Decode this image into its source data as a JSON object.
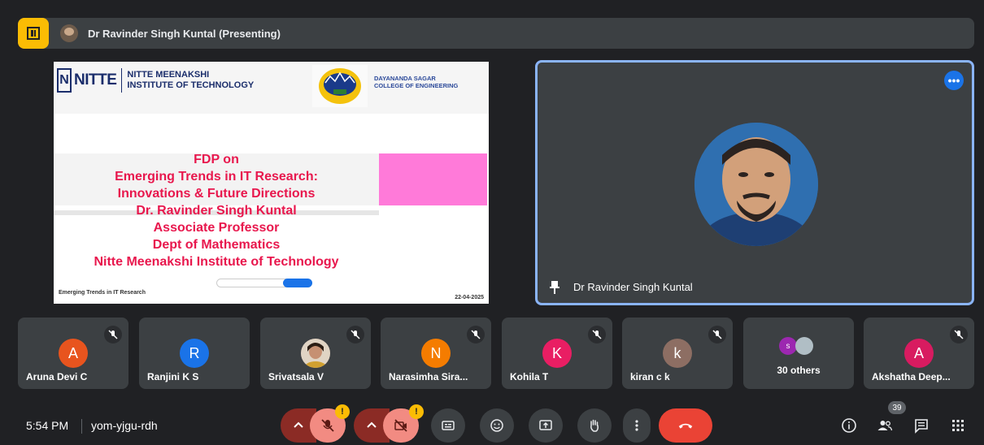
{
  "topbar": {
    "presenting_label": "Dr Ravinder Singh Kuntal (Presenting)"
  },
  "slide": {
    "nitte_word": "NITTE",
    "nitte_inst_line1": "NITTE MEENAKSHI",
    "nitte_inst_line2": "INSTITUTE OF TECHNOLOGY",
    "dsce_line1": "DAYANANDA SAGAR",
    "dsce_line2": "COLLEGE OF ENGINEERING",
    "lines": [
      "FDP on",
      "Emerging Trends in IT Research:",
      "Innovations & Future Directions",
      "Dr. Ravinder Singh Kuntal",
      "Associate Professor",
      "Dept of Mathematics",
      "Nitte Meenakshi Institute of Technology"
    ],
    "footer_left": "Emerging Trends in IT Research",
    "footer_right": "22-04-2025"
  },
  "speaker": {
    "name": "Dr Ravinder Singh Kuntal"
  },
  "participants": [
    {
      "name": "Aruna Devi C",
      "initial": "A",
      "color": "#e8541e"
    },
    {
      "name": "Ranjini K S",
      "initial": "R",
      "color": "#1a73e8"
    },
    {
      "name": "Srivatsala V",
      "initial": "",
      "color": "#8d6e63"
    },
    {
      "name": "Narasimha Sira...",
      "initial": "N",
      "color": "#f57c00"
    },
    {
      "name": "Kohila T",
      "initial": "K",
      "color": "#e91e63"
    },
    {
      "name": "kiran c k",
      "initial": "k",
      "color": "#8d6e63"
    },
    {
      "name": "30 others",
      "initial": "s",
      "color": "#9c27b0"
    },
    {
      "name": "Akshatha Deep...",
      "initial": "A",
      "color": "#d81b60"
    }
  ],
  "bottombar": {
    "time": "5:54 PM",
    "meeting_code": "yom-yjgu-rdh",
    "mic_alert": "!",
    "cam_alert": "!",
    "people_count": "39"
  },
  "colors": {
    "background": "#202124",
    "tile": "#3c4043",
    "accent_blue": "#8ab4f8",
    "hangup": "#ea4335",
    "alert": "#fbbc04",
    "slide_text": "#e8174d"
  },
  "icons": [
    "present-icon",
    "mic-off-icon",
    "camera-off-icon",
    "captions-icon",
    "emoji-icon",
    "present-screen-icon",
    "raise-hand-icon",
    "more-options-icon",
    "hangup-icon",
    "info-icon",
    "people-icon",
    "chat-icon",
    "activities-icon",
    "pin-icon"
  ]
}
